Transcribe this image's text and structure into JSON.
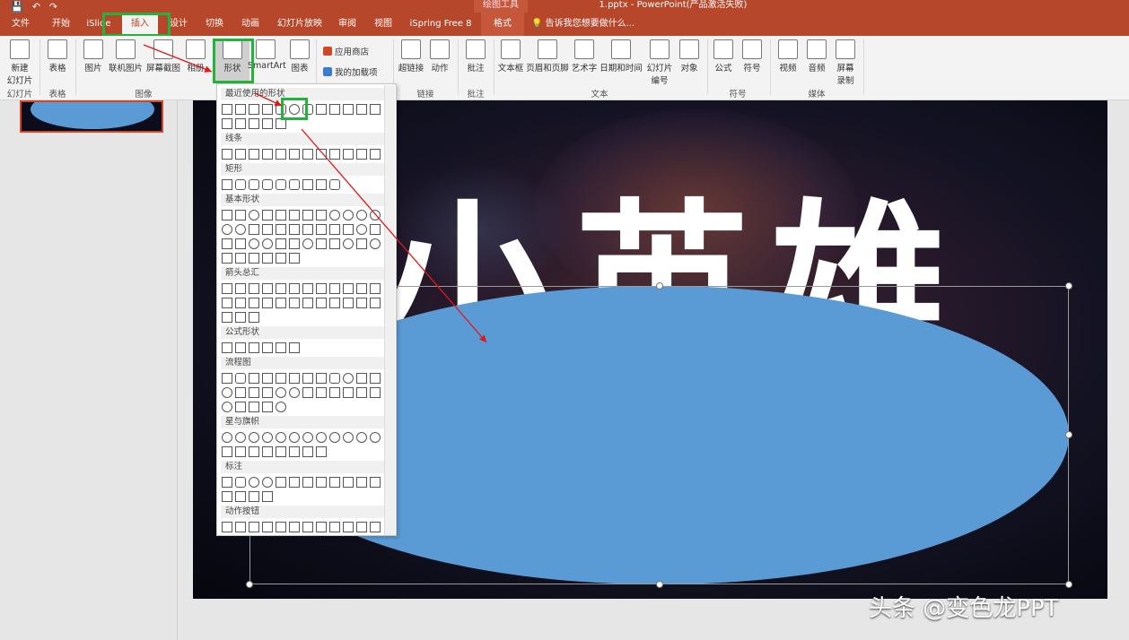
{
  "window": {
    "title": "1.pptx - PowerPoint(产品激活失败)",
    "context_tools": "绘图工具",
    "qat": [
      "💾",
      "↶",
      "↷"
    ]
  },
  "tabs": [
    {
      "label": "文件"
    },
    {
      "label": "开始"
    },
    {
      "label": "iSlide"
    },
    {
      "label": "插入"
    },
    {
      "label": "设计"
    },
    {
      "label": "切换"
    },
    {
      "label": "动画"
    },
    {
      "label": "幻灯片放映"
    },
    {
      "label": "审阅"
    },
    {
      "label": "视图"
    },
    {
      "label": "iSpring Free 8"
    },
    {
      "label": "格式"
    }
  ],
  "tell_me": "告诉我您想要做什么...",
  "ribbon": {
    "new_slide": "新建\n幻灯片",
    "table": "表格",
    "picture": "图片",
    "online_picture": "联机图片",
    "screenshot": "屏幕截图",
    "album": "相册",
    "shapes": "形状",
    "smartart": "SmartArt",
    "chart": "图表",
    "store": "应用商店",
    "my_addins": "我的加载项",
    "hyperlink": "超链接",
    "action": "动作",
    "comment": "批注",
    "textbox": "文本框",
    "header_footer": "页眉和页脚",
    "wordart": "艺术字",
    "datetime": "日期和时间",
    "slide_number": "幻灯片\n编号",
    "object": "对象",
    "equation": "公式",
    "symbol": "符号",
    "video": "视频",
    "audio": "音频",
    "screen_record": "屏幕\n录制",
    "groups": {
      "slides": "幻灯片",
      "tables": "表格",
      "images": "图像",
      "links": "链接",
      "comments": "批注",
      "text": "文本",
      "symbols": "符号",
      "media": "媒体"
    }
  },
  "shapes_menu": {
    "sections": [
      "最近使用的形状",
      "线条",
      "矩形",
      "基本形状",
      "箭头总汇",
      "公式形状",
      "流程图",
      "星与旗帜",
      "标注",
      "动作按钮"
    ]
  },
  "slide": {
    "title_text": "小英雄",
    "watermark": "头条 @变色龙PPT"
  }
}
